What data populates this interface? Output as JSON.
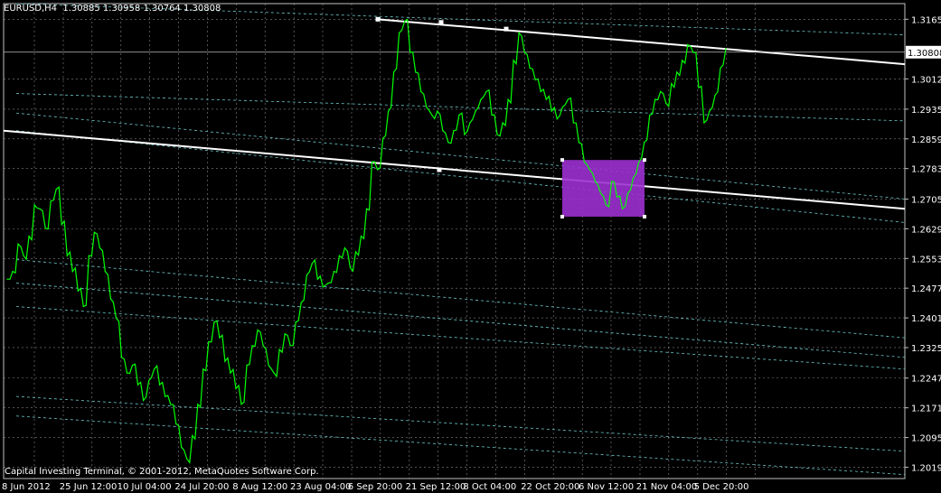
{
  "header": {
    "symbol": "EURUSD,H4",
    "ohlc": "1.30885 1.30958 1.30764 1.30808"
  },
  "copyright": "Capital Investing Terminal, © 2001-2012, MetaQuotes Software Corp.",
  "current_price_label": "1.30808",
  "colors": {
    "background": "#000000",
    "grid": "#c0c0c0",
    "price_line": "#00ff00",
    "channel_solid": "#ffffff",
    "channel_dotted": "#6ec8c8",
    "rectangle": "#9b30d0",
    "text": "#ffffff"
  },
  "chart_data": {
    "type": "line",
    "title": "EURUSD,H4",
    "y_axis_side": "right",
    "ylim": [
      1.199,
      1.3205
    ],
    "ytick_labels": [
      "1.31650",
      "1.30125",
      "1.29350",
      "1.28590",
      "1.27830",
      "1.27050",
      "1.26290",
      "1.25530",
      "1.24770",
      "1.24010",
      "1.23250",
      "1.22470",
      "1.21710",
      "1.20950",
      "1.20190"
    ],
    "ytick_values": [
      1.3165,
      1.30125,
      1.2935,
      1.2859,
      1.2783,
      1.2705,
      1.2629,
      1.2553,
      1.2477,
      1.2401,
      1.2325,
      1.2247,
      1.2171,
      1.2095,
      1.2019
    ],
    "xtick_labels": [
      "8 Jun 2012",
      "25 Jun 12:00",
      "10 Jul 04:00",
      "24 Jul 20:00",
      "8 Aug 12:00",
      "23 Aug 04:00",
      "6 Sep 20:00",
      "21 Sep 12:00",
      "8 Oct 04:00",
      "22 Oct 20:00",
      "6 Nov 12:00",
      "21 Nov 04:00",
      "5 Dec 20:00"
    ],
    "grid": true,
    "series": [
      {
        "values": [
          1.25,
          1.252,
          1.259,
          1.256,
          1.261,
          1.269,
          1.268,
          1.263,
          1.27,
          1.273,
          1.264,
          1.256,
          1.252,
          1.247,
          1.243,
          1.256,
          1.262,
          1.258,
          1.252,
          1.245,
          1.24,
          1.23,
          1.226,
          1.228,
          1.223,
          1.219,
          1.224,
          1.227,
          1.223,
          1.22,
          1.218,
          1.213,
          1.207,
          1.204,
          1.21,
          1.218,
          1.227,
          1.234,
          1.239,
          1.235,
          1.229,
          1.226,
          1.222,
          1.218,
          1.228,
          1.233,
          1.237,
          1.233,
          1.228,
          1.226,
          1.232,
          1.236,
          1.233,
          1.239,
          1.244,
          1.251,
          1.254,
          1.25,
          1.248,
          1.249,
          1.252,
          1.256,
          1.258,
          1.253,
          1.257,
          1.261,
          1.268,
          1.28,
          1.278,
          1.286,
          1.293,
          1.303,
          1.313,
          1.316,
          1.308,
          1.303,
          1.298,
          1.294,
          1.292,
          1.293,
          1.288,
          1.285,
          1.288,
          1.292,
          1.287,
          1.29,
          1.293,
          1.296,
          1.298,
          1.292,
          1.287,
          1.29,
          1.296,
          1.306,
          1.313,
          1.308,
          1.304,
          1.301,
          1.298,
          1.296,
          1.293,
          1.291,
          1.294,
          1.296,
          1.29,
          1.285,
          1.28,
          1.278,
          1.275,
          1.272,
          1.269,
          1.275,
          1.271,
          1.268,
          1.272,
          1.276,
          1.28,
          1.285,
          1.292,
          1.296,
          1.298,
          1.295,
          1.3,
          1.303,
          1.306,
          1.31,
          1.308,
          1.299,
          1.29,
          1.293,
          1.297,
          1.304,
          1.309
        ]
      }
    ],
    "annotations": {
      "rectangle": {
        "price_low": 1.266,
        "price_high": 1.2805
      }
    }
  }
}
